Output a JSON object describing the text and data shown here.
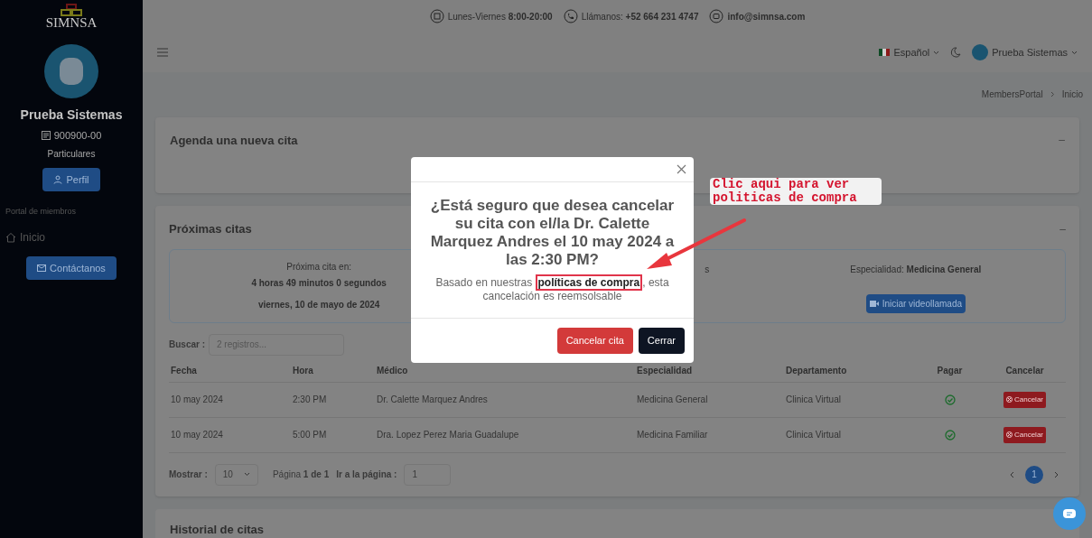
{
  "sidebar": {
    "logo": "SIMNSA",
    "user_name": "Prueba Sistemas",
    "member_id": "900900-00",
    "plan": "Particulares",
    "profile_button": "Perfil",
    "section_label": "Portal de miembros",
    "items": [
      {
        "label": "Inicio",
        "selected": false
      }
    ],
    "contact_button": "Contáctanos"
  },
  "info_bar": {
    "hours_label": "Lunes-Viernes",
    "hours": "8:00-20:00",
    "phone_label": "Llámanos:",
    "phone": "+52 664 231 4747",
    "email": "info@simnsa.com"
  },
  "header": {
    "language": "Español",
    "user": "Prueba Sistemas"
  },
  "breadcrumb": [
    "MembersPortal",
    "Inicio"
  ],
  "new_appointment": {
    "title": "Agenda una nueva cita",
    "collapse": "–"
  },
  "upcoming": {
    "title": "Próximas citas",
    "collapse": "–",
    "next": {
      "label": "Próxima cita en:",
      "countdown": "4 horas 49 minutos 0 segundos",
      "date": "viernes, 10 de mayo de 2024",
      "middle_fragment": "s",
      "specialty_label": "Especialidad:",
      "specialty": "Medicina General",
      "video_button": "Iniciar videollamada"
    },
    "search": {
      "label": "Buscar :",
      "placeholder": "2 registros..."
    },
    "table": {
      "columns": [
        "Fecha",
        "Hora",
        "Médico",
        "Especialidad",
        "Departamento",
        "Pagar",
        "Cancelar"
      ],
      "rows": [
        {
          "date": "10 may 2024",
          "time": "2:30 PM",
          "doctor": "Dr. Calette Marquez Andres",
          "specialty": "Medicina General",
          "department": "Clinica Virtual",
          "paid": true,
          "cancel": "Cancelar"
        },
        {
          "date": "10 may 2024",
          "time": "5:00 PM",
          "doctor": "Dra. Lopez Perez Maria Guadalupe",
          "specialty": "Medicina Familiar",
          "department": "Clinica Virtual",
          "paid": true,
          "cancel": "Cancelar"
        }
      ]
    },
    "pagination": {
      "show_label": "Mostrar :",
      "page_size": "10",
      "page_text": "Página **1 de 1**",
      "goto_label": "Ir a la página :",
      "goto_value": "1",
      "pages": [
        {
          "label": "1",
          "selected": true
        }
      ]
    }
  },
  "history": {
    "title": "Historial de citas"
  },
  "modal": {
    "title": "¿Está seguro que desea cancelar su cita con el/la Dr. Calette Marquez Andres el 10 may 2024 a las 2:30 PM?",
    "text_before": "Basado en nuestras",
    "link": "políticas de compra",
    "text_after": ", esta cancelación es reemsolsable",
    "confirm_button": "Cancelar cita",
    "close_button": "Cerrar"
  },
  "annotation": {
    "text": "Clic aqui para ver politicas de compra"
  }
}
